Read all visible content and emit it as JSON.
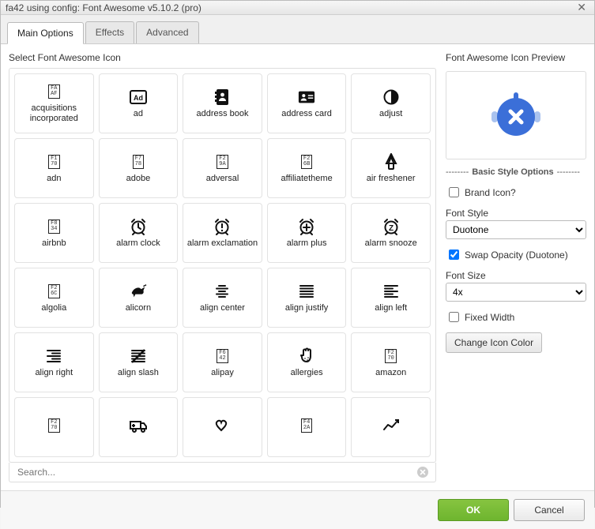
{
  "window": {
    "title": "fa42 using config: Font Awesome v5.10.2 (pro)"
  },
  "tabs": [
    {
      "label": "Main Options",
      "active": true
    },
    {
      "label": "Effects"
    },
    {
      "label": "Advanced"
    }
  ],
  "left": {
    "label": "Select Font Awesome Icon",
    "search_placeholder": "Search...",
    "icons": [
      {
        "label": "acquisitions incorporated",
        "glyph": "code",
        "code": "FA\nAF"
      },
      {
        "label": "ad",
        "glyph": "ad"
      },
      {
        "label": "address book",
        "glyph": "addressbook"
      },
      {
        "label": "address card",
        "glyph": "addresscard"
      },
      {
        "label": "adjust",
        "glyph": "adjust"
      },
      {
        "label": "adn",
        "glyph": "code",
        "code": "F1\n70"
      },
      {
        "label": "adobe",
        "glyph": "code",
        "code": "F7\n78"
      },
      {
        "label": "adversal",
        "glyph": "code",
        "code": "F2\n9A"
      },
      {
        "label": "affiliatetheme",
        "glyph": "code",
        "code": "F2\n6B"
      },
      {
        "label": "air freshener",
        "glyph": "airfreshener"
      },
      {
        "label": "airbnb",
        "glyph": "code",
        "code": "F8\n34"
      },
      {
        "label": "alarm clock",
        "glyph": "alarm"
      },
      {
        "label": "alarm exclamation",
        "glyph": "alarm-ex"
      },
      {
        "label": "alarm plus",
        "glyph": "alarm-plus"
      },
      {
        "label": "alarm snooze",
        "glyph": "alarm-z"
      },
      {
        "label": "algolia",
        "glyph": "code",
        "code": "F2\n6C"
      },
      {
        "label": "alicorn",
        "glyph": "alicorn"
      },
      {
        "label": "align center",
        "glyph": "align-center"
      },
      {
        "label": "align justify",
        "glyph": "align-justify"
      },
      {
        "label": "align left",
        "glyph": "align-left"
      },
      {
        "label": "align right",
        "glyph": "align-right"
      },
      {
        "label": "align slash",
        "glyph": "align-slash"
      },
      {
        "label": "alipay",
        "glyph": "code",
        "code": "F6\n42"
      },
      {
        "label": "allergies",
        "glyph": "allergies"
      },
      {
        "label": "amazon",
        "glyph": "code",
        "code": "F2\n70"
      },
      {
        "label": "",
        "glyph": "code",
        "code": "F2\n70"
      },
      {
        "label": "",
        "glyph": "ambulance"
      },
      {
        "label": "",
        "glyph": "asl"
      },
      {
        "label": "",
        "glyph": "code",
        "code": "F4\n2A"
      },
      {
        "label": "",
        "glyph": "analytics"
      }
    ]
  },
  "right": {
    "preview_label": "Font Awesome Icon Preview",
    "style_heading": "Basic Style Options",
    "brand_label": "Brand Icon?",
    "brand_checked": false,
    "fontstyle_label": "Font Style",
    "fontstyle_value": "Duotone",
    "swap_label": "Swap Opacity (Duotone)",
    "swap_checked": true,
    "fontsize_label": "Font Size",
    "fontsize_value": "4x",
    "fixed_label": "Fixed Width",
    "fixed_checked": false,
    "change_color_label": "Change Icon Color"
  },
  "footer": {
    "ok": "OK",
    "cancel": "Cancel"
  }
}
